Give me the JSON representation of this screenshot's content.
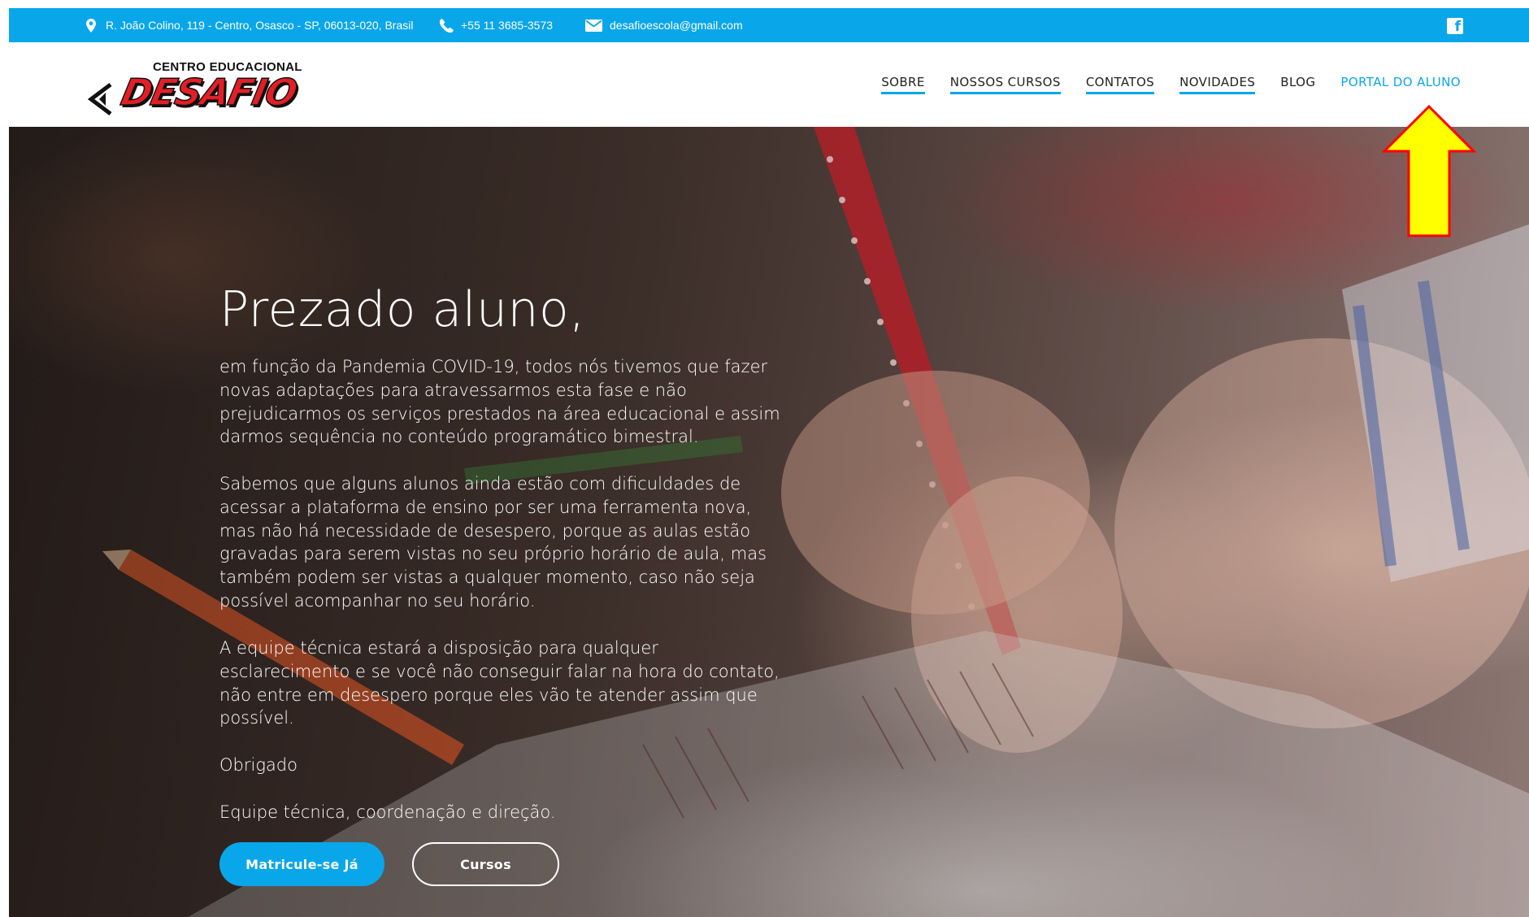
{
  "topbar": {
    "address": "R. João Colino, 119 - Centro, Osasco - SP, 06013-020, Brasil",
    "phone": "+55 11 3685-3573",
    "email": "desafioescola@gmail.com",
    "background_color": "#0aa6ea",
    "icons": [
      "map-pin-icon",
      "phone-icon",
      "envelope-icon",
      "facebook-icon"
    ]
  },
  "logo": {
    "subtitle": "CENTRO EDUCACIONAL",
    "title": "DESAFIO"
  },
  "nav": {
    "items": [
      {
        "label": "SOBRE"
      },
      {
        "label": "NOSSOS CURSOS"
      },
      {
        "label": "CONTATOS"
      },
      {
        "label": "NOVIDADES"
      },
      {
        "label": "BLOG"
      },
      {
        "label": "PORTAL DO ALUNO"
      }
    ],
    "accent_color": "#0aa6ea"
  },
  "hero": {
    "heading": "Prezado aluno,",
    "paragraphs": [
      "em função da Pandemia COVID-19, todos nós tivemos que fazer novas adaptações para atravessarmos esta fase e não prejudicarmos os serviços prestados na área educacional e assim darmos sequência no conteúdo programático bimestral.",
      "Sabemos que alguns alunos ainda estão com dificuldades de acessar a plataforma de ensino por ser uma ferramenta nova, mas não há necessidade de desespero, porque as aulas estão gravadas para serem vistas no seu próprio horário de aula, mas também podem ser vistas a qualquer momento, caso não seja possível acompanhar no seu horário.",
      "A equipe técnica estará a disposição para qualquer esclarecimento e se você não conseguir falar na hora do contato, não entre em desespero porque eles vão te atender assim que possível.",
      "Obrigado",
      "Equipe técnica, coordenação e direção."
    ],
    "primary_button": "Matricule-se Já",
    "secondary_button": "Cursos"
  },
  "annotation": {
    "icon": "yellow-arrow-up-icon",
    "fill_color": "#ffff00",
    "stroke_color": "#ff0000"
  }
}
